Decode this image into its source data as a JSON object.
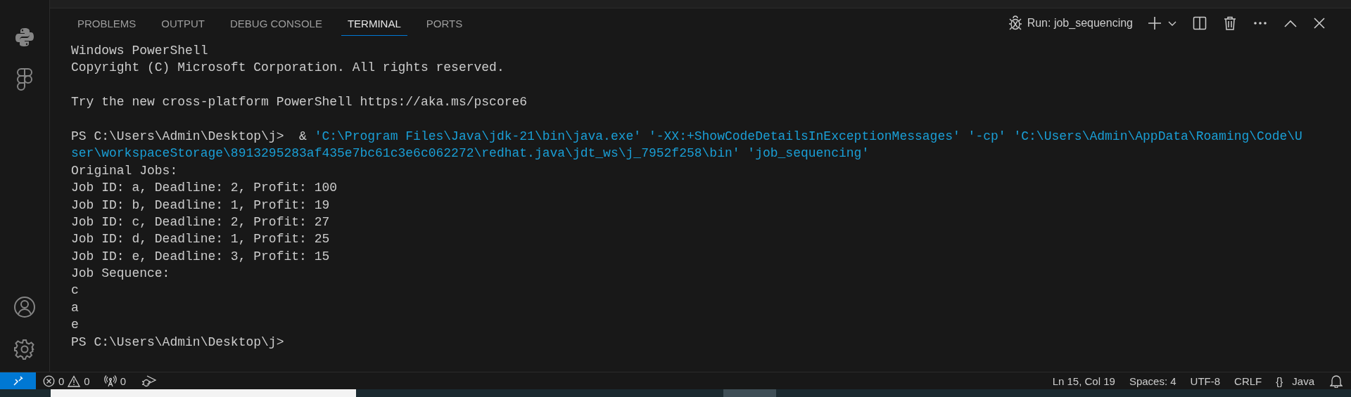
{
  "panel_tabs": [
    {
      "label": "PROBLEMS",
      "selected": false
    },
    {
      "label": "OUTPUT",
      "selected": false
    },
    {
      "label": "DEBUG CONSOLE",
      "selected": false
    },
    {
      "label": "TERMINAL",
      "selected": true
    },
    {
      "label": "PORTS",
      "selected": false
    }
  ],
  "terminal_toolbar": {
    "run_label": "Run: job_sequencing"
  },
  "terminal_lines": [
    {
      "prompt": "Windows PowerShell"
    },
    {
      "prompt": "Copyright (C) Microsoft Corporation. All rights reserved."
    },
    {
      "gap_before": true,
      "prompt": "Try the new cross-platform PowerShell https://aka.ms/pscore6"
    },
    {
      "gap_before": true,
      "prompt": "PS C:\\Users\\Admin\\Desktop\\j>  & ",
      "command": "'C:\\Program Files\\Java\\jdk-21\\bin\\java.exe' '-XX:+ShowCodeDetailsInExceptionMessages' '-cp' 'C:\\Users\\Admin\\AppData\\Roaming\\Code\\U"
    },
    {
      "command": "ser\\workspaceStorage\\8913295283af435e7bc61c3e6c062272\\redhat.java\\jdt_ws\\j_7952f258\\bin' 'job_sequencing'"
    },
    {
      "prompt": "Original Jobs:"
    },
    {
      "prompt": "Job ID: a, Deadline: 2, Profit: 100"
    },
    {
      "prompt": "Job ID: b, Deadline: 1, Profit: 19"
    },
    {
      "prompt": "Job ID: c, Deadline: 2, Profit: 27"
    },
    {
      "prompt": "Job ID: d, Deadline: 1, Profit: 25"
    },
    {
      "prompt": "Job ID: e, Deadline: 3, Profit: 15"
    },
    {
      "prompt": "Job Sequence:"
    },
    {
      "prompt": "c"
    },
    {
      "prompt": "a"
    },
    {
      "prompt": "e"
    },
    {
      "prompt": "PS C:\\Users\\Admin\\Desktop\\j>"
    }
  ],
  "status_bar": {
    "errors": "0",
    "warnings": "0",
    "ports": "0",
    "position": "Ln 15, Col 19",
    "spaces": "Spaces: 4",
    "encoding": "UTF-8",
    "eol": "CRLF",
    "braces": "{}",
    "language": "Java"
  }
}
